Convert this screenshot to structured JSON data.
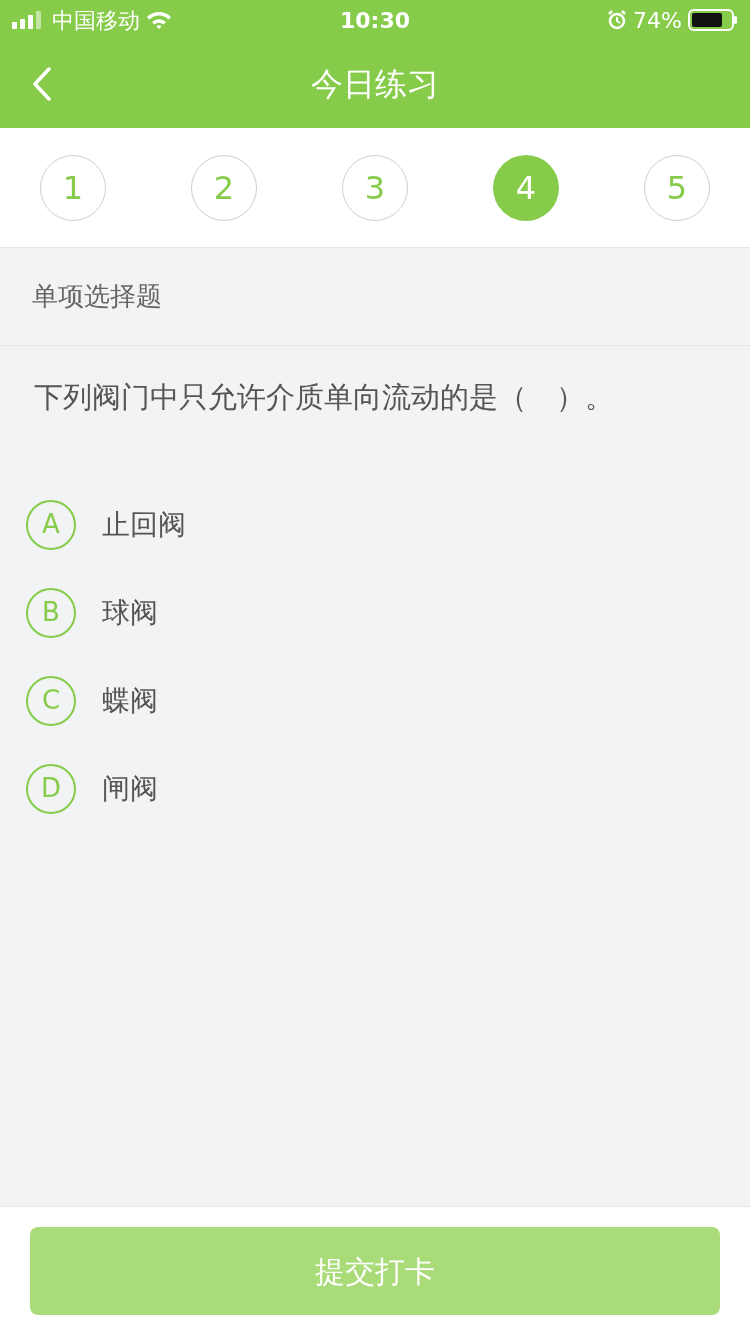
{
  "status_bar": {
    "carrier": "中国移动",
    "time": "10:30",
    "battery": "74%"
  },
  "nav": {
    "title": "今日练习"
  },
  "steps": [
    {
      "label": "1",
      "selected": false
    },
    {
      "label": "2",
      "selected": false
    },
    {
      "label": "3",
      "selected": false
    },
    {
      "label": "4",
      "selected": true
    },
    {
      "label": "5",
      "selected": false
    }
  ],
  "section": {
    "title": "单项选择题"
  },
  "question": {
    "text": "下列阀门中只允许介质单向流动的是（　）。"
  },
  "options": [
    {
      "letter": "A",
      "text": "止回阀",
      "selected": false
    },
    {
      "letter": "B",
      "text": "球阀",
      "selected": false
    },
    {
      "letter": "C",
      "text": "蝶阀",
      "selected": false
    },
    {
      "letter": "D",
      "text": "闸阀",
      "selected": false
    }
  ],
  "submit": {
    "label": "提交打卡",
    "disabled": true
  }
}
